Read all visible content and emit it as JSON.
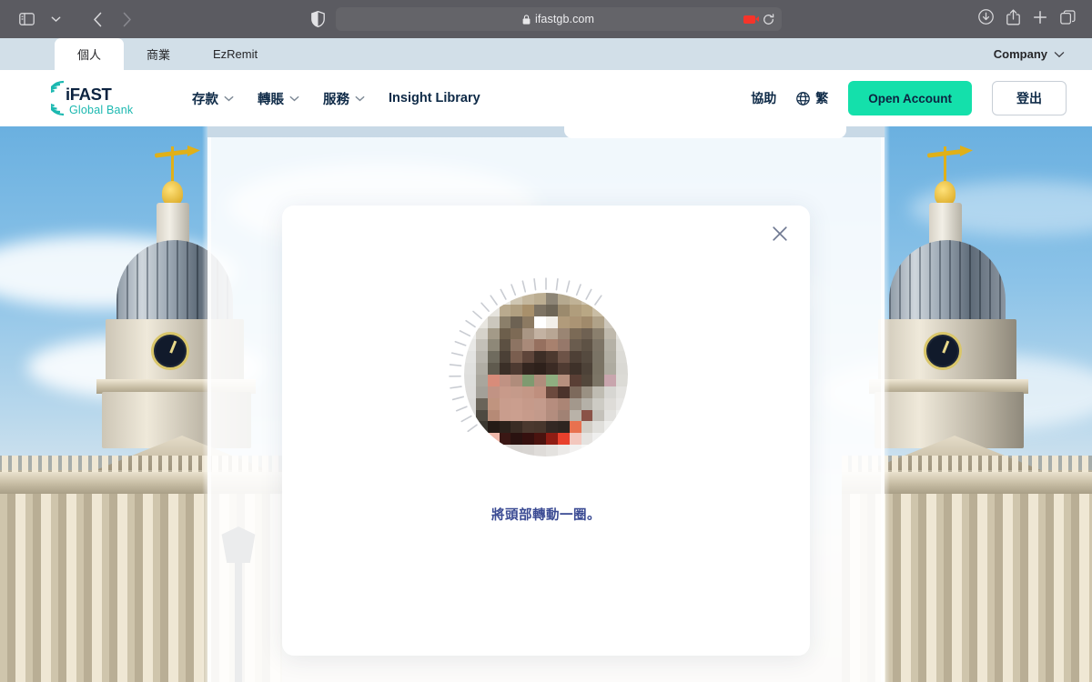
{
  "browser": {
    "sidebar_icon": "sidebar-toggle-icon",
    "back_icon": "back-arrow-icon",
    "forward_icon": "forward-arrow-icon",
    "shield_icon": "privacy-shield-icon",
    "lock_icon": "lock-icon",
    "url": "ifastgb.com",
    "recording_icon": "screen-recording-indicator",
    "reload_icon": "reload-icon",
    "download_icon": "download-icon",
    "share_icon": "share-icon",
    "newtab_icon": "plus-icon",
    "tabs_icon": "tab-overview-icon"
  },
  "tabstrip": {
    "tabs": [
      {
        "label": "個人",
        "active": true
      },
      {
        "label": "商業",
        "active": false
      },
      {
        "label": "EzRemit",
        "active": false
      }
    ],
    "company_label": "Company",
    "company_chevron": "chevron-down-icon"
  },
  "site_header": {
    "logo": {
      "brand": "iFAST",
      "sub": "Global Bank"
    },
    "nav": [
      {
        "label": "存款",
        "has_chevron": true
      },
      {
        "label": "轉賬",
        "has_chevron": true
      },
      {
        "label": "服務",
        "has_chevron": true
      },
      {
        "label": "Insight Library",
        "has_chevron": false
      }
    ],
    "help_label": "協助",
    "lang_label": "繁",
    "globe_icon": "globe-icon",
    "open_account_label": "Open Account",
    "logout_label": "登出"
  },
  "modal": {
    "close_icon": "close-icon",
    "camera_label": "liveness-camera-preview",
    "instruction": "將頭部轉動一圈。"
  },
  "colors": {
    "accent_teal": "#14e0ab",
    "brand_navy": "#0e2a47",
    "instruction_blue": "#3a4a93",
    "chrome_gray": "#5b5b61",
    "tabstrip_blue": "#d2dfe8",
    "record_red": "#f5342a"
  }
}
